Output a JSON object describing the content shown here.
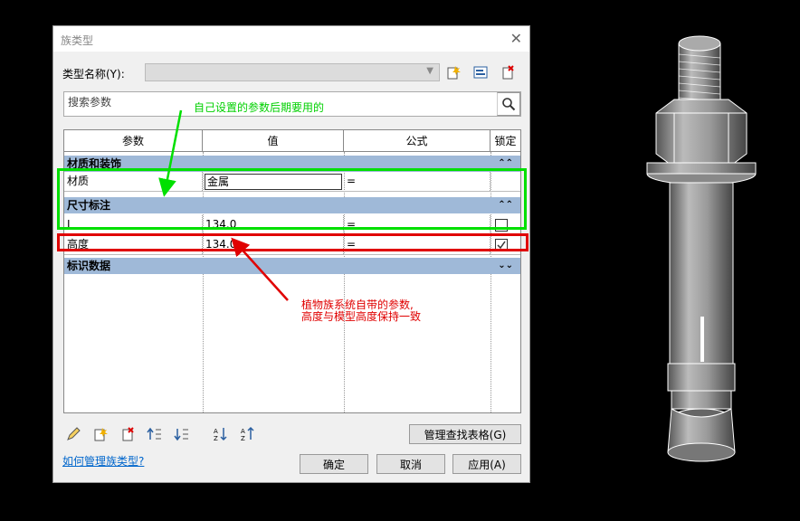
{
  "dialog": {
    "title": "族类型",
    "type_name_label": "类型名称(Y):",
    "type_name_value": "",
    "search_placeholder": "搜索参数"
  },
  "table": {
    "headers": [
      "参数",
      "值",
      "公式",
      "锁定"
    ],
    "groups": [
      {
        "name": "材质和装饰",
        "chevron": "⌃⌃",
        "rows": [
          {
            "param": "材质",
            "value": "金属",
            "formula": "=",
            "locked": null
          }
        ]
      },
      {
        "name": "尺寸标注",
        "chevron": "⌃⌃",
        "rows": [
          {
            "param": "L",
            "value": "134.0",
            "formula": "=",
            "locked": false
          },
          {
            "param": "高度",
            "value": "134.0",
            "formula": "=",
            "locked": true
          }
        ]
      },
      {
        "name": "标识数据",
        "chevron": "⌄⌄",
        "rows": []
      }
    ]
  },
  "buttons": {
    "manage_lookup": "管理查找表格(G)",
    "ok": "确定",
    "cancel": "取消",
    "apply": "应用(A)"
  },
  "link": "如何管理族类型?",
  "annotations": {
    "green": "自己设置的参数后期要用的",
    "red_line1": "植物族系统自带的参数,",
    "red_line2": "高度与模型高度保持一致"
  },
  "colors": {
    "group_header": "#9fb9d8",
    "green": "#00e000",
    "red": "#e00000",
    "link": "#0066cc"
  }
}
